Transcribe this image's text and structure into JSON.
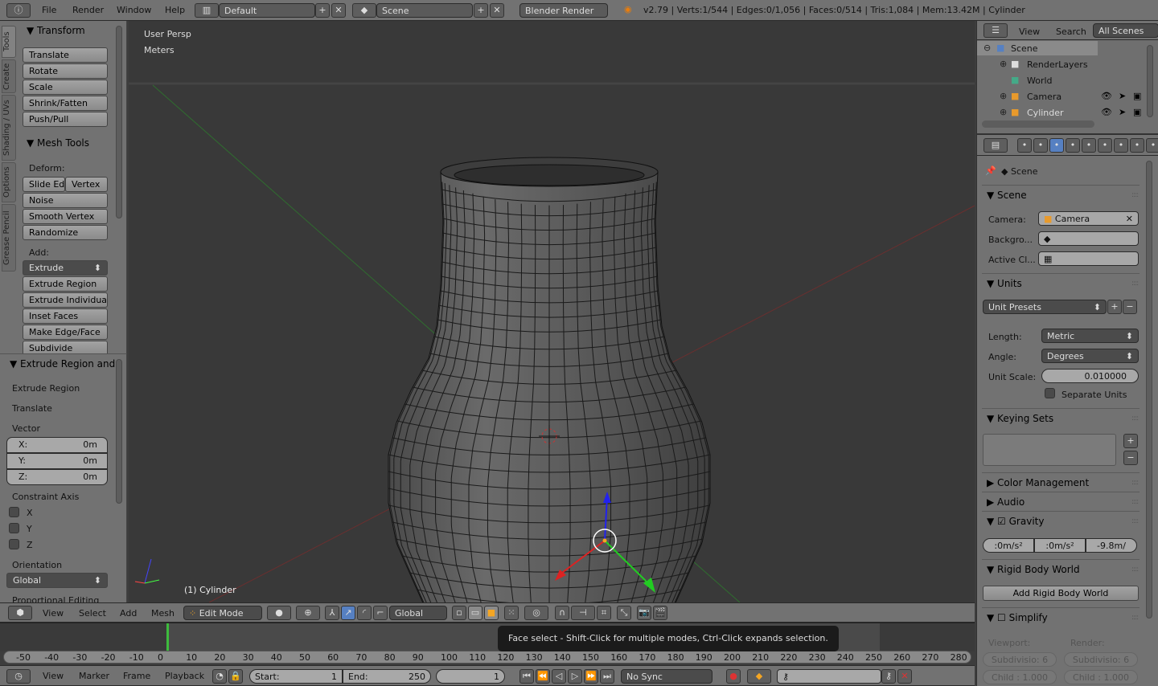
{
  "topbar": {
    "menus": [
      "File",
      "Render",
      "Window",
      "Help"
    ],
    "layout": "Default",
    "scene": "Scene",
    "engine": "Blender Render",
    "stats": "v2.79 | Verts:1/544 | Edges:0/1,056 | Faces:0/514 | Tris:1,084 | Mem:13.42M | Cylinder"
  },
  "tool_tabs": [
    "Tools",
    "Create",
    "Shading / UVs",
    "Options",
    "Grease Pencil"
  ],
  "tools": {
    "transform_title": "Transform",
    "transform": [
      "Translate",
      "Rotate",
      "Scale",
      "Shrink/Fatten",
      "Push/Pull"
    ],
    "mesh_tools_title": "Mesh Tools",
    "deform_label": "Deform:",
    "slide_edge": "Slide Ed",
    "vertex": "Vertex",
    "deform": [
      "Noise",
      "Smooth Vertex",
      "Randomize"
    ],
    "add_label": "Add:",
    "extrude": "Extrude",
    "add": [
      "Extrude Region",
      "Extrude Individual",
      "Inset Faces",
      "Make Edge/Face",
      "Subdivide"
    ]
  },
  "operator": {
    "title": "Extrude Region and",
    "items": [
      "Extrude Region",
      "Translate"
    ],
    "vector_label": "Vector",
    "vector": [
      {
        "label": "X:",
        "value": "0m"
      },
      {
        "label": "Y:",
        "value": "0m"
      },
      {
        "label": "Z:",
        "value": "0m"
      }
    ],
    "constraint_label": "Constraint Axis",
    "axes": [
      "X",
      "Y",
      "Z"
    ],
    "orientation_label": "Orientation",
    "orientation": "Global",
    "proportional": "Proportional Editing"
  },
  "viewport": {
    "view": "User Persp",
    "units": "Meters",
    "object": "(1) Cylinder"
  },
  "view3d_header": {
    "menus": [
      "View",
      "Select",
      "Add",
      "Mesh"
    ],
    "mode": "Edit Mode",
    "orientation": "Global"
  },
  "tooltip": "Face select - Shift-Click for multiple modes, Ctrl-Click expands selection.",
  "timeline": {
    "ticks": [
      "-50",
      "-40",
      "-30",
      "-20",
      "-10",
      "0",
      "10",
      "20",
      "30",
      "40",
      "50",
      "60",
      "70",
      "80",
      "90",
      "100",
      "110",
      "120",
      "130",
      "140",
      "150",
      "160",
      "170",
      "180",
      "190",
      "200",
      "210",
      "220",
      "230",
      "240",
      "250",
      "260",
      "270",
      "280"
    ],
    "menus": [
      "View",
      "Marker",
      "Frame",
      "Playback"
    ],
    "start_label": "Start:",
    "start": "1",
    "end_label": "End:",
    "end": "250",
    "current": "1",
    "sync": "No Sync",
    "current_frame": 0
  },
  "outliner": {
    "menus": [
      "View",
      "Search"
    ],
    "filter": "All Scenes",
    "items": [
      "Scene",
      "RenderLayers",
      "World",
      "Camera",
      "Cylinder"
    ]
  },
  "properties": {
    "context": "Scene",
    "scene_panel": "Scene",
    "camera_label": "Camera:",
    "camera": "Camera",
    "background_label": "Backgro...",
    "active_clip_label": "Active Cl...",
    "units_panel": "Units",
    "unit_presets": "Unit Presets",
    "length_label": "Length:",
    "length": "Metric",
    "angle_label": "Angle:",
    "angle": "Degrees",
    "scale_label": "Unit Scale:",
    "scale": "0.010000",
    "separate": "Separate Units",
    "keying_panel": "Keying Sets",
    "color_mgmt": "Color Management",
    "audio": "Audio",
    "gravity": "Gravity",
    "gravity_values": [
      ":0m/s²",
      ":0m/s²",
      "-9.8m/"
    ],
    "rigid_panel": "Rigid Body World",
    "rigid_button": "Add Rigid Body World",
    "simplify": "Simplify",
    "viewport_label": "Viewport:",
    "render_label": "Render:",
    "subdiv_vp": "Subdivisio: 6",
    "subdiv_r": "Subdivisio: 6",
    "child_vp": "Child : 1.000",
    "child_r": "Child : 1.000"
  },
  "colors": {
    "viewport": "#393939",
    "panel": "#727272",
    "selected": "#5680c2",
    "accent": "#f5a623"
  }
}
